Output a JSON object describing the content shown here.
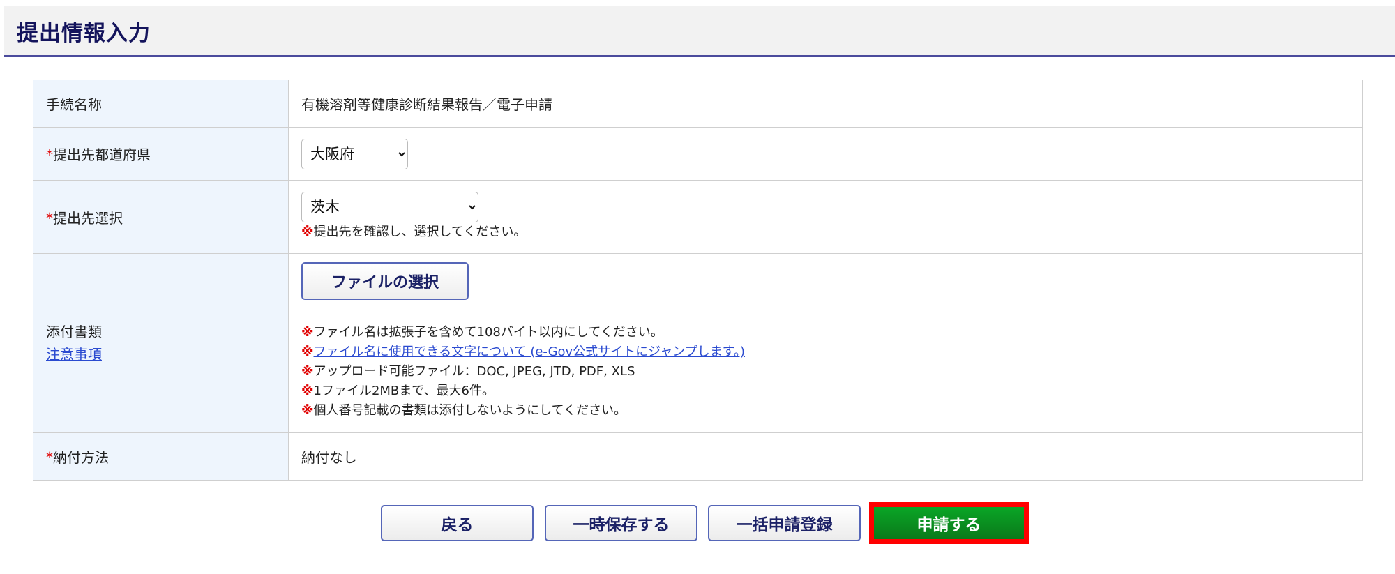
{
  "header": {
    "title": "提出情報入力"
  },
  "form": {
    "procedure": {
      "label": "手続名称",
      "value": "有機溶剤等健康診断結果報告／電子申請"
    },
    "prefecture": {
      "required_mark": "*",
      "label": "提出先都道府県",
      "selected": "大阪府"
    },
    "destination": {
      "required_mark": "*",
      "label": "提出先選択",
      "selected": "茨木",
      "note_mark": "※",
      "note": "提出先を確認し、選択してください。"
    },
    "attachments": {
      "label": "添付書類",
      "caution_link": "注意事項",
      "file_button": "ファイルの選択",
      "note_mark": "※",
      "notes": [
        "ファイル名は拡張子を含めて108バイト以内にしてください。",
        "ファイル名に使用できる文字について (e-Gov公式サイトにジャンプします。)",
        "アップロード可能ファイル：DOC, JPEG, JTD, PDF, XLS",
        "1ファイル2MBまで、最大6件。",
        "個人番号記載の書類は添付しないようにしてください。"
      ]
    },
    "payment": {
      "required_mark": "*",
      "label": "納付方法",
      "value": "納付なし"
    }
  },
  "buttons": {
    "back": "戻る",
    "save": "一時保存する",
    "batch": "一括申請登録",
    "submit": "申請する"
  },
  "colors": {
    "title": "#14145c",
    "submit": "#0a8f20",
    "highlight": "#ff0000",
    "label_bg": "#eef5fd"
  }
}
